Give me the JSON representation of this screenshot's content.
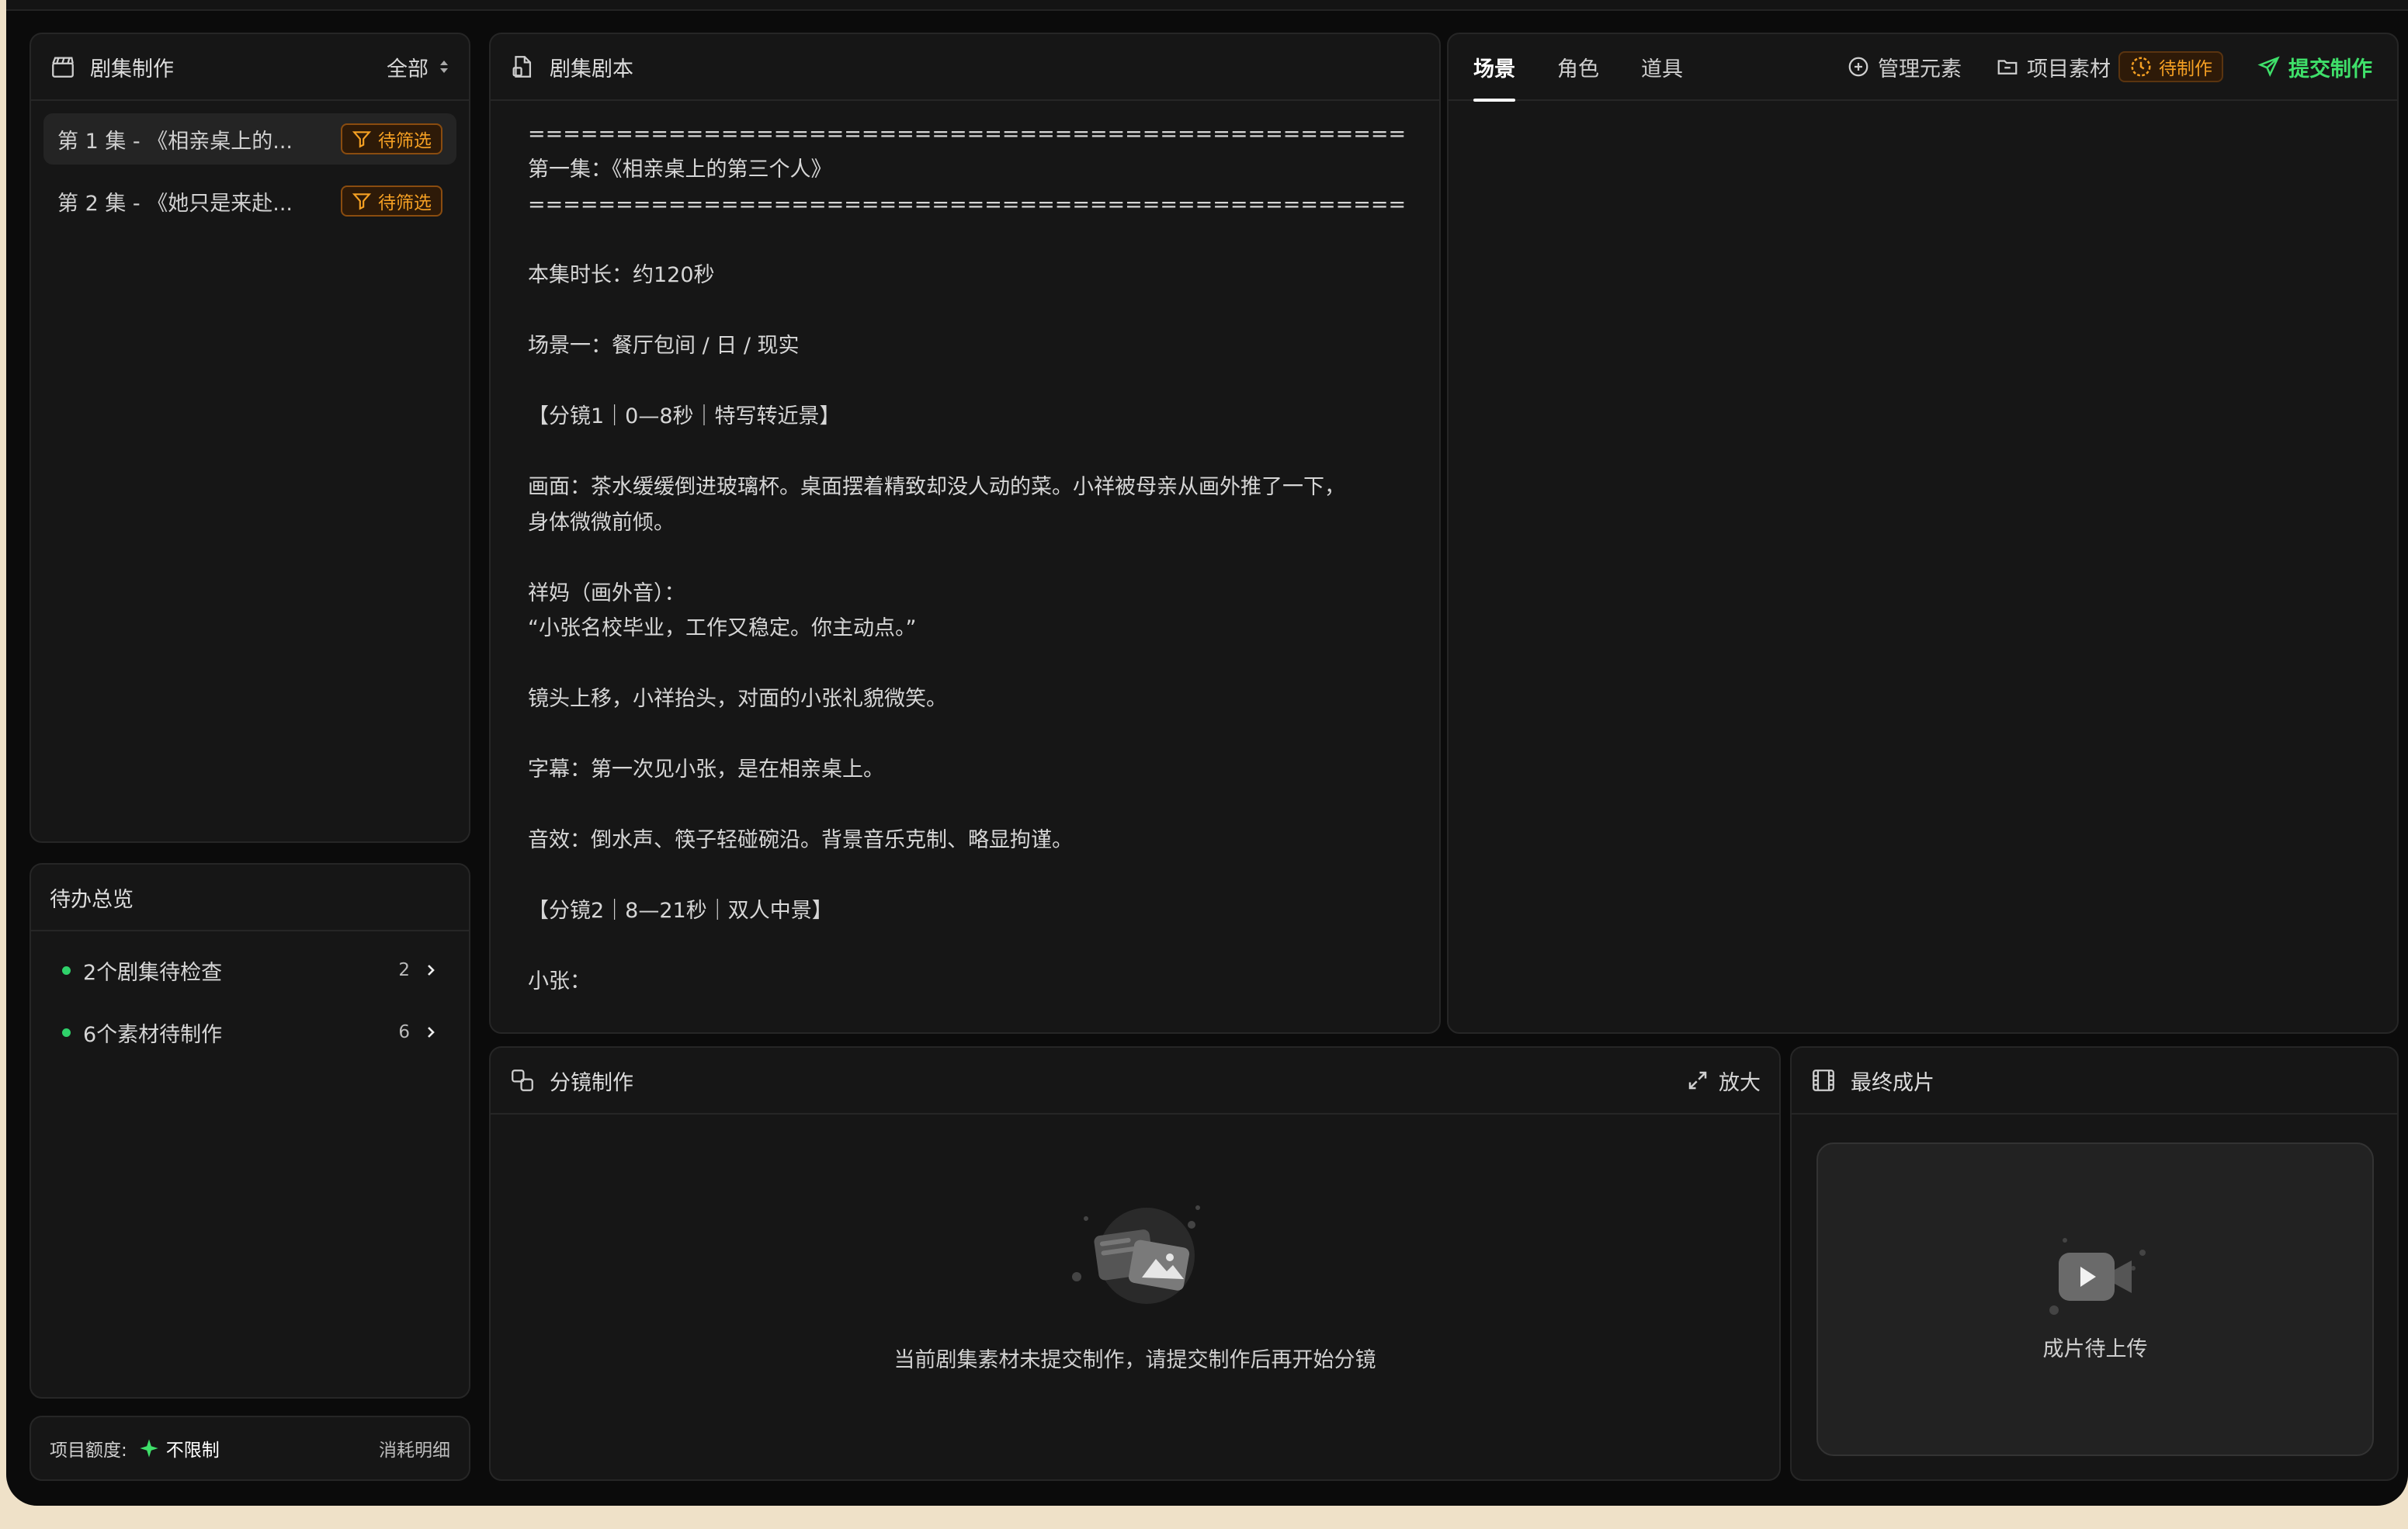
{
  "sidebar": {
    "title": "剧集制作",
    "filter_label": "全部",
    "episodes": [
      {
        "label": "第 1 集 - 《相亲桌上的...",
        "badge": "待筛选"
      },
      {
        "label": "第 2 集 - 《她只是来赴...",
        "badge": "待筛选"
      }
    ]
  },
  "todo": {
    "title": "待办总览",
    "items": [
      {
        "label": "2个剧集待检查",
        "count": "2"
      },
      {
        "label": "6个素材待制作",
        "count": "6"
      }
    ]
  },
  "quota": {
    "label": "项目额度:",
    "value": "不限制",
    "detail_link": "消耗明细"
  },
  "script_panel": {
    "title": "剧集剧本",
    "content": "==================================================\n第一集：《相亲桌上的第三个人》\n==================================================\n\n本集时长：约120秒\n\n场景一：餐厅包间 / 日 / 现实\n\n【分镜1｜0—8秒｜特写转近景】\n\n画面：茶水缓缓倒进玻璃杯。桌面摆着精致却没人动的菜。小祥被母亲从画外推了一下，\n身体微微前倾。\n\n祥妈（画外音）：\n“小张名校毕业，工作又稳定。你主动点。”\n\n镜头上移，小祥抬头，对面的小张礼貌微笑。\n\n字幕：第一次见小张，是在相亲桌上。\n\n音效：倒水声、筷子轻碰碗沿。背景音乐克制、略显拘谨。\n\n【分镜2｜8—21秒｜双人中景】\n\n小张："
  },
  "elements_panel": {
    "tabs": [
      "场景",
      "角色",
      "道具"
    ],
    "active_tab": "场景",
    "manage_label": "管理元素",
    "assets_label": "项目素材",
    "assets_badge": "待制作",
    "submit_label": "提交制作"
  },
  "storyboard_panel": {
    "title": "分镜制作",
    "zoom_label": "放大",
    "empty_message": "当前剧集素材未提交制作，请提交制作后再开始分镜"
  },
  "final_panel": {
    "title": "最终成片",
    "empty_message": "成片待上传"
  },
  "colors": {
    "accent_green": "#3fe06a",
    "badge_orange": "#f5a023",
    "background": "#0b0b0b",
    "panel": "#161616"
  }
}
